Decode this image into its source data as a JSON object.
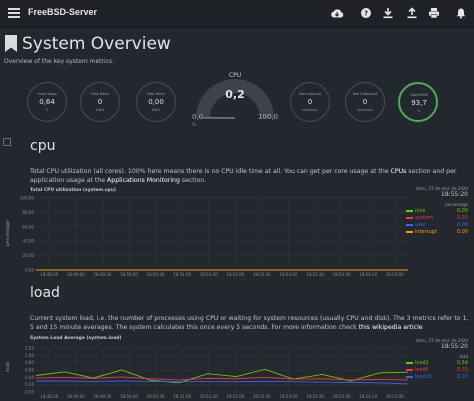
{
  "app": {
    "title": "FreeBSD-Server"
  },
  "header": {
    "title": "System Overview",
    "subtitle": "Overview of the key system metrics."
  },
  "gauges": [
    {
      "label": "Used Swap",
      "value": "0,64",
      "unit": "%"
    },
    {
      "label": "Disk Read",
      "value": "0",
      "unit": "KiB/s"
    },
    {
      "label": "Disk Write",
      "value": "0,00",
      "unit": "KiB/s"
    },
    {
      "label": "Net Inbound",
      "value": "0",
      "unit": "kilobits/s"
    },
    {
      "label": "Net Outbound",
      "value": "0",
      "unit": "kilobits/s"
    },
    {
      "label": "Used RAM",
      "value": "93,7",
      "unit": "%"
    }
  ],
  "cpu_gauge": {
    "label": "CPU",
    "value": "0,2",
    "min": "0,0",
    "max": "100,0",
    "unit": "%",
    "fraction": 0.002
  },
  "cpu_section": {
    "title": "cpu",
    "desc_1": "Total CPU utilization (all cores). 100% here means there is no CPU idle time at all. You can get per core usage at the ",
    "link_1": "CPUs",
    "desc_2": " section and per application usage at the ",
    "link_2": "Applications Monitoring",
    "desc_3": " section.",
    "chart_title": "Total CPU utilization (system.cpu)",
    "ylabel": "percentage",
    "legend": {
      "date": "dom., 17 de mar. de 2020",
      "time": "18:55:20",
      "unit": "percentage",
      "items": [
        {
          "name": "nice",
          "value": "0,00",
          "color": "#66cc00"
        },
        {
          "name": "system",
          "value": "0,10",
          "color": "#ff3333"
        },
        {
          "name": "user",
          "value": "0,00",
          "color": "#3366ff"
        },
        {
          "name": "interrupt",
          "value": "0,00",
          "color": "#ff9900"
        }
      ]
    }
  },
  "load_section": {
    "title": "load",
    "desc_1": "Current system load, i.e. the number of processes using CPU or waiting for system resources (usually CPU and disk). The 3 metrics refer to 1, 5 and 15 minute averages. The system calculates this once every 5 seconds. For more information check ",
    "link_1": "this wikipedia article",
    "chart_title": "System Load Average (system.load)",
    "ylabel": "load",
    "legend": {
      "date": "dom., 17 de mar. de 2020",
      "time": "18:55:20",
      "unit": "load",
      "items": [
        {
          "name": "load1",
          "value": "0,54",
          "color": "#66cc00"
        },
        {
          "name": "load5",
          "value": "0,33",
          "color": "#ff3333"
        },
        {
          "name": "load15",
          "value": "0,22",
          "color": "#3366ff"
        }
      ]
    }
  },
  "chart_data": [
    {
      "type": "area",
      "title": "Total CPU utilization (system.cpu)",
      "ylabel": "percentage",
      "ylim": [
        0,
        100
      ],
      "yticks": [
        "100,00",
        "80,00",
        "60,00",
        "40,00",
        "20,00",
        "0,00"
      ],
      "xticks": [
        "18:48:30",
        "18:49:00",
        "18:49:30",
        "18:50:00",
        "18:50:30",
        "18:51:00",
        "18:51:30",
        "18:52:00",
        "18:52:30",
        "18:53:00",
        "18:53:30",
        "18:54:00",
        "18:54:30",
        "18:55:00"
      ],
      "grid": true,
      "legend_position": "right",
      "series": [
        {
          "name": "nice",
          "color": "#66cc00",
          "values": [
            0,
            0,
            0,
            0,
            0,
            0,
            0,
            0,
            0,
            0,
            0,
            0,
            0,
            0
          ]
        },
        {
          "name": "system",
          "color": "#ff3333",
          "values": [
            0.1,
            0.2,
            0.1,
            0.1,
            0.2,
            0.1,
            0.1,
            0.1,
            0.2,
            0.1,
            0.1,
            0.1,
            0.2,
            0.1
          ]
        },
        {
          "name": "user",
          "color": "#3366ff",
          "values": [
            0.1,
            0.1,
            0.1,
            0.2,
            0.1,
            0.1,
            0.1,
            0.2,
            0.1,
            0.1,
            0.1,
            0.1,
            0.1,
            0.1
          ]
        },
        {
          "name": "interrupt",
          "color": "#ff9900",
          "values": [
            0,
            0,
            0,
            0,
            0,
            0,
            0,
            0,
            0,
            0,
            0,
            0,
            0,
            0
          ]
        }
      ]
    },
    {
      "type": "line",
      "title": "System Load Average (system.load)",
      "ylabel": "load",
      "ylim": [
        0,
        1.2
      ],
      "yticks": [
        "1,20",
        "1,00",
        "0,80",
        "0,60",
        "0,40",
        "0,20",
        "0,00"
      ],
      "xticks": [
        "18:48:30",
        "18:49:00",
        "18:49:30",
        "18:50:00",
        "18:50:30",
        "18:51:00",
        "18:51:30",
        "18:52:00",
        "18:52:30",
        "18:53:00",
        "18:53:30",
        "18:54:00",
        "18:54:30",
        "18:55:00"
      ],
      "grid": true,
      "legend_position": "right",
      "series": [
        {
          "name": "load1",
          "color": "#66cc00",
          "values": [
            0.45,
            0.55,
            0.38,
            0.6,
            0.32,
            0.25,
            0.5,
            0.42,
            0.62,
            0.35,
            0.48,
            0.3,
            0.52,
            0.54
          ]
        },
        {
          "name": "load5",
          "color": "#ff3333",
          "values": [
            0.38,
            0.4,
            0.37,
            0.41,
            0.36,
            0.33,
            0.37,
            0.36,
            0.4,
            0.35,
            0.36,
            0.33,
            0.34,
            0.33
          ]
        },
        {
          "name": "load15",
          "color": "#3366ff",
          "values": [
            0.3,
            0.3,
            0.29,
            0.3,
            0.29,
            0.28,
            0.28,
            0.28,
            0.29,
            0.28,
            0.27,
            0.26,
            0.25,
            0.22
          ]
        }
      ]
    }
  ]
}
